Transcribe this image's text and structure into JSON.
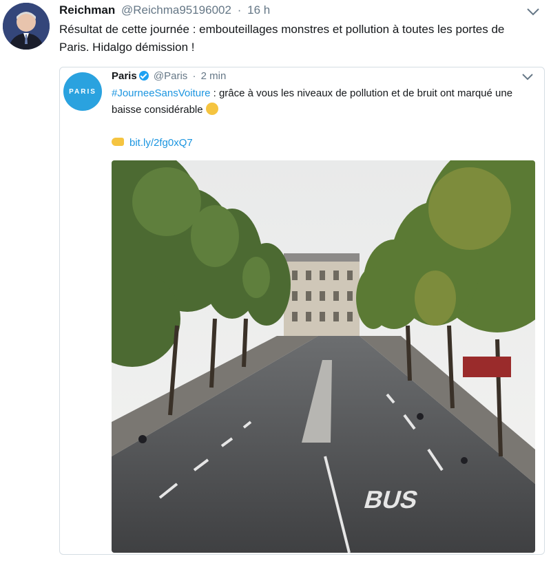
{
  "tweet": {
    "author_name": "Reichman",
    "author_handle": "@Reichma95196002",
    "separator": "·",
    "time": "16 h",
    "text": "Résultat de cette journée : embouteillages monstres et pollution à toutes les portes de Paris. Hidalgo démission !"
  },
  "quoted_tweet": {
    "author_name": "Paris",
    "author_handle": "@Paris",
    "separator": "·",
    "time": "2 min",
    "avatar_text": "PARIS",
    "hashtag": "#JourneeSansVoiture",
    "text": " : grâce à vous les niveaux de pollution et de bruit ont marqué une baisse considérable",
    "link": "bit.ly/2fg0xQ7"
  },
  "icons": [
    "chevron-down-icon",
    "verified-badge-icon",
    "clapping-hands-emoji",
    "pointing-hand-emoji"
  ],
  "colors": {
    "link": "#1b95e0",
    "muted": "#657786",
    "paris_brand": "#2aa2df"
  }
}
